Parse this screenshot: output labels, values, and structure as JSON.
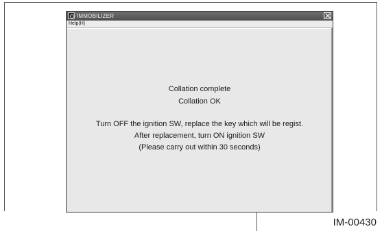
{
  "window": {
    "title": "IMMOBILIZER",
    "app_icon": "immobilizer-app-icon",
    "close_icon": "close-icon"
  },
  "menu": {
    "help": "Help(H)"
  },
  "message": {
    "status_1": "Collation complete",
    "status_2": "Collation OK",
    "instruction_1": "Turn OFF the ignition SW, replace the key which will be regist.",
    "instruction_2": "After replacement, turn ON ignition SW",
    "instruction_3": "(Please carry out within 30 seconds)"
  },
  "figure": {
    "label": "IM-00430"
  }
}
